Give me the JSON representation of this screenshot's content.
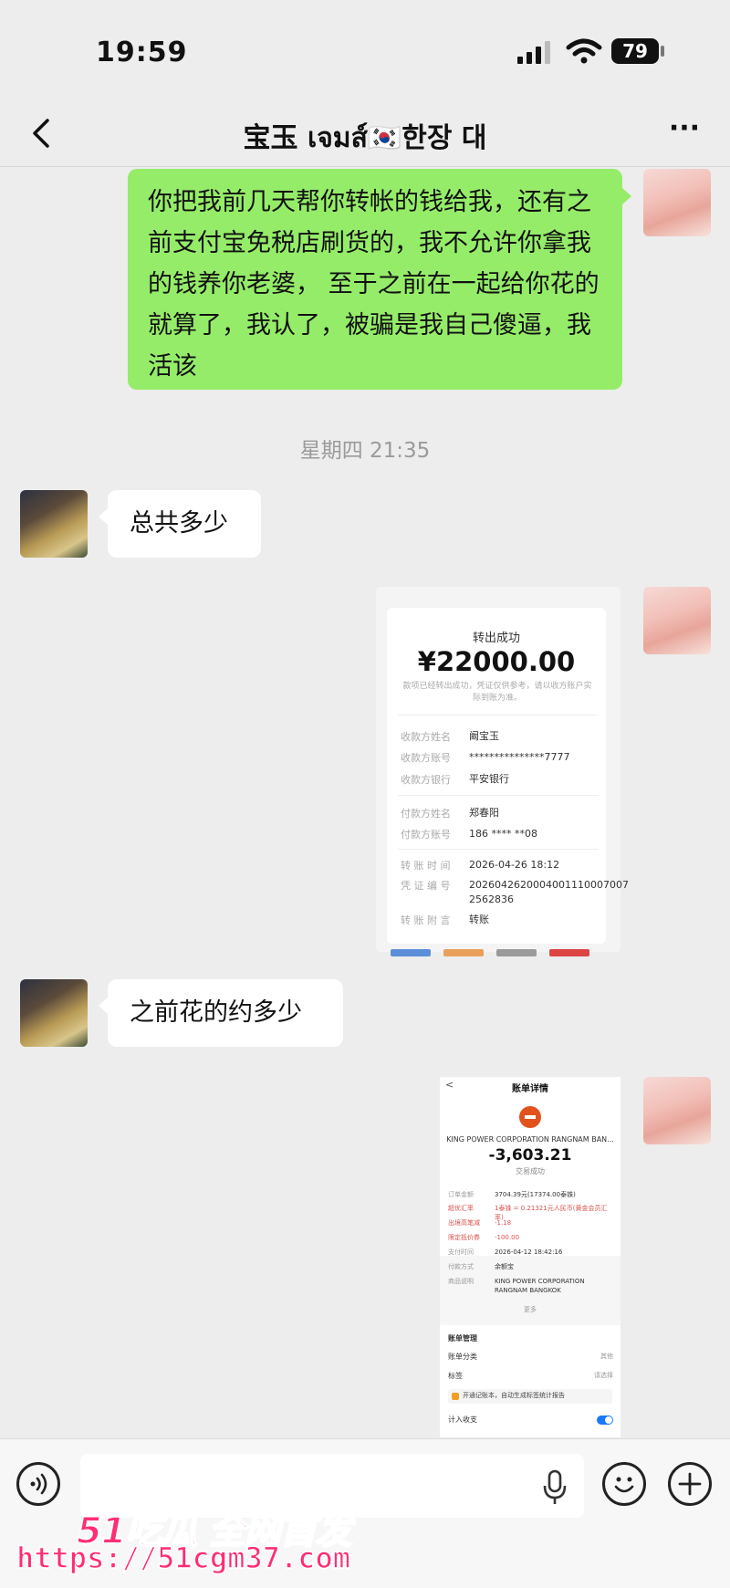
{
  "status_bar": {
    "time": "19:59",
    "battery": "79"
  },
  "header": {
    "title": "宝玉 เจมส์🇰🇷한장 대",
    "more_glyph": "···"
  },
  "messages": {
    "m1": "你把我前几天帮你转帐的钱给我，还有之前支付宝免税店刷货的，我不允许你拿我的钱养你老婆， 至于之前在一起给你花的就算了，我认了，被骗是我自己傻逼，我活该",
    "timestamp": "星期四 21:35",
    "m2": "总共多少",
    "m3": "之前花的约多少"
  },
  "transfer_receipt": {
    "title": "转出成功",
    "amount": "¥22000.00",
    "note": "款项已经转出成功，凭证仅供参考，请以收方账户实际到账为准。",
    "rows": [
      {
        "label": "收款方姓名",
        "value": "阚宝玉"
      },
      {
        "label": "收款方账号",
        "value": "***************7777"
      },
      {
        "label": "收款方银行",
        "value": "平安银行"
      },
      {
        "label": "付款方姓名",
        "value": "郑春阳"
      },
      {
        "label": "付款方账号",
        "value": "186 **** **08"
      },
      {
        "label": "转 账 时 间",
        "value": "2026-04-26 18:12"
      },
      {
        "label": "凭 证 编 号",
        "value": "2026042620004001110007007 2562836"
      },
      {
        "label": "转 账 附 言",
        "value": "转账"
      }
    ]
  },
  "bill_detail": {
    "header": "账单详情",
    "merchant": "KING POWER CORPORATION RANGNAM BAN...",
    "amount": "-3,603.21",
    "status": "交易成功",
    "rows": [
      {
        "label": "订单金额",
        "value": "3704.39元(17374.00泰铢)"
      },
      {
        "label": "超优汇率",
        "value": "1泰铢 = 0.21321元人民币(黄金会员汇率)"
      },
      {
        "label": "出境高笔减",
        "value": "-1.18"
      },
      {
        "label": "限定抵价券",
        "value": "-100.00"
      },
      {
        "label": "支付时间",
        "value": "2026-04-12 18:42:16"
      },
      {
        "label": "付款方式",
        "value": "余额宝"
      },
      {
        "label": "商品说明",
        "value": "KING POWER CORPORATION RANGNAM BANGKOK"
      }
    ],
    "more": "更多",
    "manage_title": "账单管理",
    "category_label": "账单分类",
    "category_value": "其他",
    "tag_label": "标签",
    "tag_value": "请选择",
    "banner": "开通记账本，自动生成标签统计报告",
    "income_label": "计入收支"
  },
  "watermark": {
    "brand": "51吃瓜 全网首发",
    "url": "https://51cgm37.com"
  },
  "colors": {
    "sent_bubble": "#95ec69",
    "received_bubble": "#ffffff",
    "background": "#ededed",
    "watermark": "#ff2d74"
  },
  "icons": [
    "signal-icon",
    "wifi-icon",
    "battery-icon",
    "back-chevron-icon",
    "more-icon",
    "voice-icon",
    "mic-icon",
    "emoji-icon",
    "plus-icon"
  ]
}
